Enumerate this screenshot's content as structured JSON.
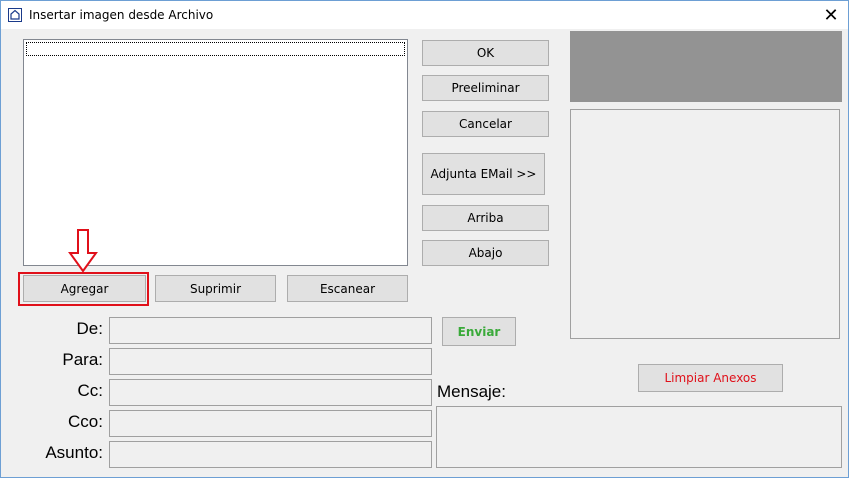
{
  "window": {
    "title": "Insertar imagen desde Archivo",
    "close_glyph": "✕"
  },
  "buttons": {
    "ok": "OK",
    "preeliminar": "Preeliminar",
    "cancelar": "Cancelar",
    "adjunta_email": "Adjunta EMail >>",
    "arriba": "Arriba",
    "abajo": "Abajo",
    "agregar": "Agregar",
    "suprimir": "Suprimir",
    "escanear": "Escanear",
    "enviar": "Enviar",
    "limpiar_anexos": "Limpiar Anexos"
  },
  "labels": {
    "de": "De:",
    "para": "Para:",
    "cc": "Cc:",
    "cco": "Cco:",
    "asunto": "Asunto:",
    "mensaje": "Mensaje:"
  },
  "colors": {
    "enviar": "#3aaa3a",
    "limpiar_anexos": "#e0101a",
    "highlight": "#e0101a"
  },
  "icons": {
    "app": "app-window-icon",
    "arrow": "down-arrow-annotation-icon"
  }
}
